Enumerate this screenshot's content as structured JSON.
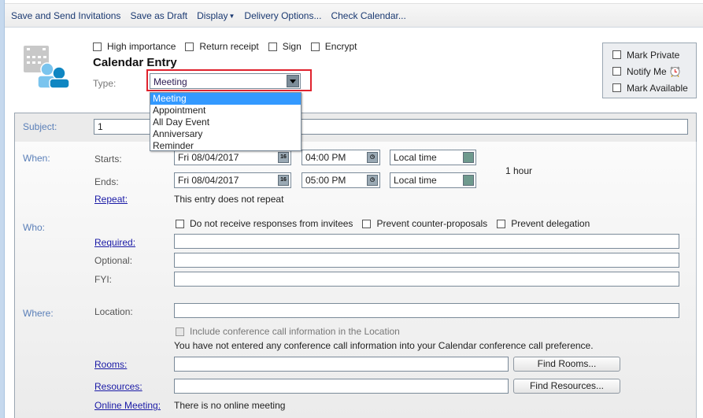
{
  "toolbar": {
    "save_send": "Save and Send Invitations",
    "save_draft": "Save as Draft",
    "display": "Display",
    "delivery_options": "Delivery Options...",
    "check_calendar": "Check Calendar..."
  },
  "header": {
    "options": [
      {
        "label": "High importance",
        "checked": false
      },
      {
        "label": "Return receipt",
        "checked": false
      },
      {
        "label": "Sign",
        "checked": false
      },
      {
        "label": "Encrypt",
        "checked": false
      }
    ],
    "title": "Calendar Entry",
    "type_label": "Type:",
    "type_value": "Meeting",
    "type_options": [
      "Meeting",
      "Appointment",
      "All Day Event",
      "Anniversary",
      "Reminder"
    ],
    "flags": [
      {
        "label": "Mark Private",
        "checked": false
      },
      {
        "label": "Notify Me",
        "checked": false
      },
      {
        "label": "Mark Available",
        "checked": false
      }
    ]
  },
  "subject": {
    "label": "Subject:",
    "value": "1"
  },
  "when": {
    "section": "When:",
    "starts_label": "Starts:",
    "ends_label": "Ends:",
    "start_date": "Fri 08/04/2017",
    "start_time": "04:00 PM",
    "start_zone": "Local time",
    "end_date": "Fri 08/04/2017",
    "end_time": "05:00 PM",
    "end_zone": "Local time",
    "duration": "1 hour",
    "calendar_glyph": "16",
    "repeat_label": "Repeat:",
    "repeat_text": "This entry does not repeat"
  },
  "who": {
    "section": "Who:",
    "options": [
      {
        "label": "Do not receive responses from invitees",
        "checked": false
      },
      {
        "label": "Prevent counter-proposals",
        "checked": false
      },
      {
        "label": "Prevent delegation",
        "checked": false
      }
    ],
    "required_label": "Required:",
    "required_value": "",
    "optional_label": "Optional:",
    "optional_value": "",
    "fyi_label": "FYI:",
    "fyi_value": ""
  },
  "where": {
    "section": "Where:",
    "location_label": "Location:",
    "location_value": "",
    "conf_call_label": "Include conference call information in the Location",
    "conf_call_note": "You have not entered any conference call information into your Calendar conference call preference.",
    "rooms_label": "Rooms:",
    "rooms_value": "",
    "find_rooms": "Find Rooms...",
    "resources_label": "Resources:",
    "resources_value": "",
    "find_resources": "Find Resources...",
    "online_label": "Online Meeting:",
    "online_text": "There is no online meeting"
  }
}
